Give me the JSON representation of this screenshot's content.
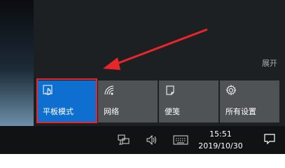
{
  "action_center": {
    "expand_label": "展开",
    "tiles": [
      {
        "label": "平板模式",
        "icon": "tablet-mode-icon",
        "active": true
      },
      {
        "label": "网络",
        "icon": "network-icon",
        "active": false
      },
      {
        "label": "便笺",
        "icon": "note-icon",
        "active": false
      },
      {
        "label": "所有设置",
        "icon": "gear-icon",
        "active": false
      }
    ]
  },
  "taskbar": {
    "time": "15:51",
    "date": "2019/10/30",
    "tray_icons": [
      "network-wired-icon",
      "volume-icon",
      "keyboard-icon"
    ]
  },
  "colors": {
    "accent": "#0f6fd0",
    "highlight": "#e8262a",
    "tile": "#4f5356",
    "panel": "#1d2022",
    "taskbar": "#101214"
  }
}
